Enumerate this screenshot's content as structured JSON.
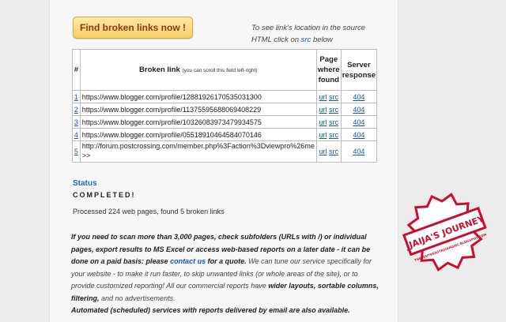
{
  "button": {
    "label": "Find broken links now !"
  },
  "hint": {
    "line1": "To see link's location in the source",
    "line2_pre": "HTML click on",
    "line2_link": "src",
    "line2_post": "below"
  },
  "table": {
    "headers": {
      "num": "#",
      "broken": "Broken link",
      "broken_note": "(you can scroll this field left-right)",
      "page": [
        "Page",
        "where",
        "found"
      ],
      "server": [
        "Server",
        "response"
      ]
    },
    "rows": [
      {
        "num": "1",
        "url": "https://www.blogger.com/profile/12881926170535031300",
        "link_url": "url",
        "link_src": "src",
        "response": "404"
      },
      {
        "num": "2",
        "url": "https://www.blogger.com/profile/11375595688069408229",
        "link_url": "url",
        "link_src": "src",
        "response": "404"
      },
      {
        "num": "3",
        "url": "https://www.blogger.com/profile/10326083973479934575",
        "link_url": "url",
        "link_src": "src",
        "response": "404"
      },
      {
        "num": "4",
        "url": "https://www.blogger.com/profile/05518910464584070146",
        "link_url": "url",
        "link_src": "src",
        "response": "404"
      },
      {
        "num": "5",
        "url": "http://forum.postcrossing.com/member.php%3Faction%3Dviewpro%26me",
        "url_cont": ">>",
        "link_url": "url",
        "link_src": "src",
        "response": "404"
      }
    ]
  },
  "status": {
    "title": "Status",
    "value": "COMPLETED!",
    "processed": "Processed 224 web pages, found 5 broken links"
  },
  "info": {
    "p1": "If you need to scan more than 3,000 pages, check subfolders (URLs with /) or individual pages, export results to MS Excel or access web-based reports on a later date - it can be done on a paid basis: please",
    "contact": "contact us",
    "p2": "for a quote.",
    "p3": "We can tune our service specifically for your website - to make it run faster, to skip unwanted links (or whole areas of the site), or to provide customized reporting! All our commercial reports have",
    "p4": "wider layouts, sortable columns, filtering,",
    "p5": "and no advertisements.",
    "p6": "Automated (scheduled) services with reports delivered by email are also available."
  },
  "stamp": {
    "title": "JJAIJA'S JOURNEY",
    "url": "THESOUTHEASTASIANGIRL.BLOGSPOT.COM",
    "color": "#c8102e"
  },
  "colors": {
    "link": "#1a56b8",
    "status": "#1a6cb8",
    "button_text": "#8b3a12"
  }
}
